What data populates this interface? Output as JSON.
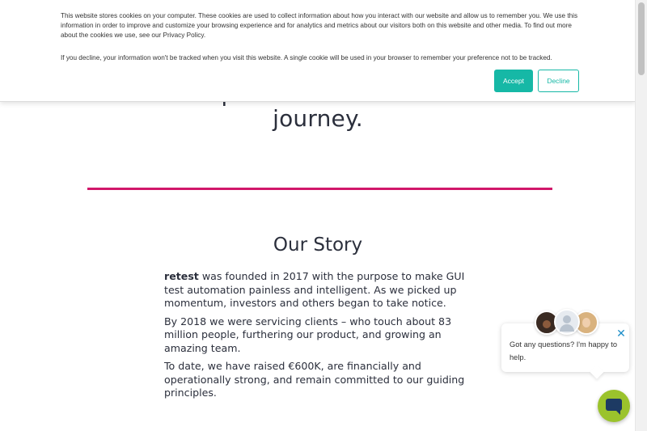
{
  "hero": {
    "line1": "step of the automation",
    "line2": "journey."
  },
  "story": {
    "title": "Our Story",
    "brand": "retest",
    "p1_rest": " was founded in 2017 with the purpose to make GUI test automation painless and intelligent. As we picked up momentum, investors and others began to take notice.",
    "p2": "By 2018 we were servicing clients – who touch about 83 million people, furthering our product, and growing an amazing team.",
    "p3": "To date, we have raised €600K, are financially and operationally strong, and remain committed to our guiding principles."
  },
  "cookie_banner": {
    "text1": "This website stores cookies on your computer. These cookies are used to collect information about how you interact with our website and allow us to remember you. We use this information in order to improve and customize your browsing experience and for analytics and metrics about our visitors both on this website and other media. To find out more about the cookies we use, see our Privacy Policy.",
    "text2": "If you decline, your information won't be tracked when you visit this website. A single cookie will be used in your browser to remember your preference not to be tracked.",
    "accept_label": "Accept",
    "decline_label": "Decline"
  },
  "chat": {
    "message": "Got any questions? I'm happy to help.",
    "close_glyph": "✕"
  },
  "colors": {
    "accent_teal": "#16b8a6",
    "divider_magenta": "#d1176a",
    "chat_launcher": "#9bc32c"
  },
  "icons": [
    "close-icon",
    "chat-icon",
    "avatar"
  ]
}
